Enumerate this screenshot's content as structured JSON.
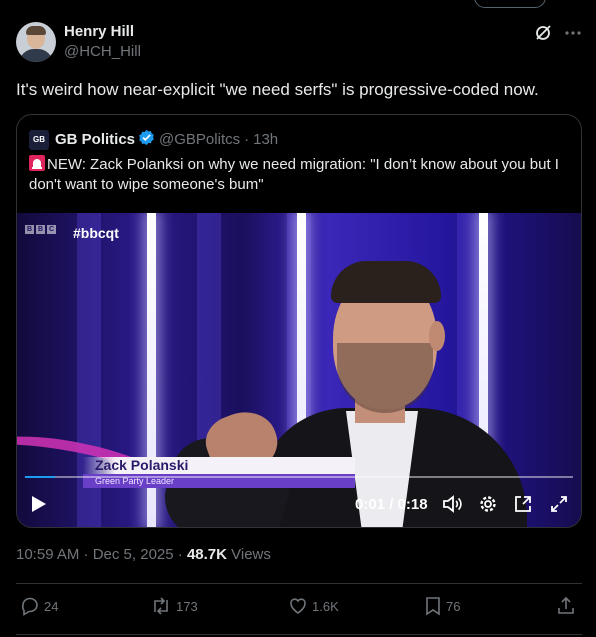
{
  "post": {
    "author_name": "Henry Hill",
    "author_handle": "@HCH_Hill",
    "text": "It's weird how near-explicit \"we need serfs\" is progressive-coded now."
  },
  "quote": {
    "logo_text": "GB",
    "name": "GB Politics",
    "handle": "@GBPolitcs",
    "separator": "·",
    "time": "13h",
    "text": "NEW: Zack Polanksi on why we need migration: \"I don’t know about you but I don't want to wipe someone's bum\""
  },
  "video": {
    "network_logo": [
      "B",
      "B",
      "C"
    ],
    "hashtag": "#bbcqt",
    "caption_name": "Zack Polanski",
    "caption_title": "Green Party Leader",
    "time_display": "0:01 / 0:18",
    "progress": 0.055
  },
  "meta": {
    "timestamp": "10:59 AM · Dec 5, 2025 · ",
    "views_count": "48.7K",
    "views_label": " Views"
  },
  "actions": {
    "replies": "24",
    "reposts": "173",
    "likes": "1.6K",
    "bookmarks": "76"
  },
  "colors": {
    "accent": "#1d9bf0",
    "background": "#000000",
    "muted_text": "#71767b",
    "border": "#2f3336"
  }
}
